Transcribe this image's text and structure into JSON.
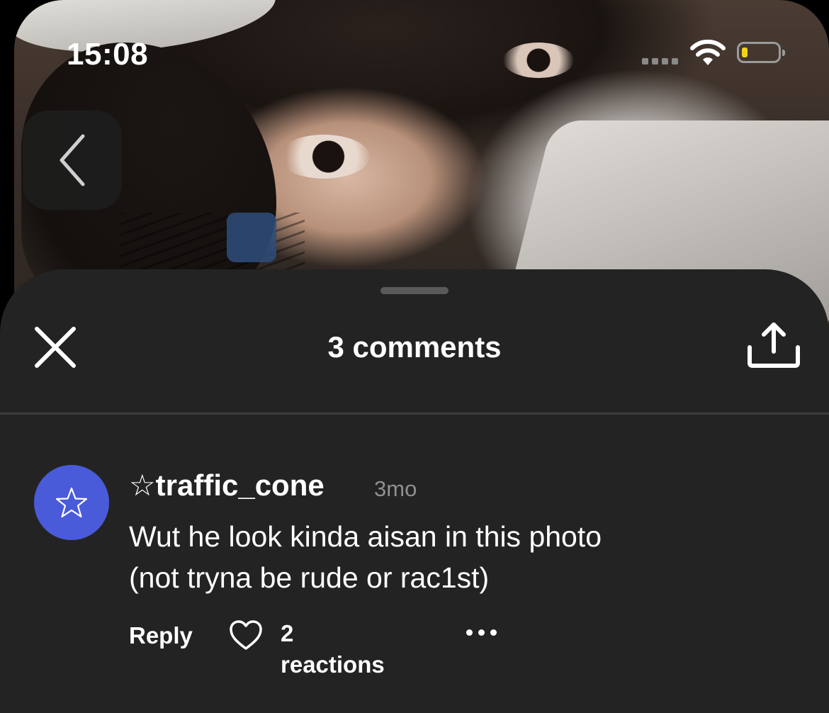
{
  "status_bar": {
    "time": "15:08"
  },
  "photo": {
    "icon": "back-chevron-icon"
  },
  "comments_sheet": {
    "title": "3 comments",
    "close_icon": "close-icon",
    "share_icon": "share-icon"
  },
  "comments": [
    {
      "avatar_icon": "star-icon",
      "avatar_color": "#4a5bd9",
      "username": "☆traffic_cone",
      "time": "3mo",
      "text_line1": "Wut he look kinda aisan in this photo",
      "text_line2": "(not tryna be rude or rac1st)",
      "reply_label": "Reply",
      "reactions_label": "2 reactions"
    }
  ]
}
